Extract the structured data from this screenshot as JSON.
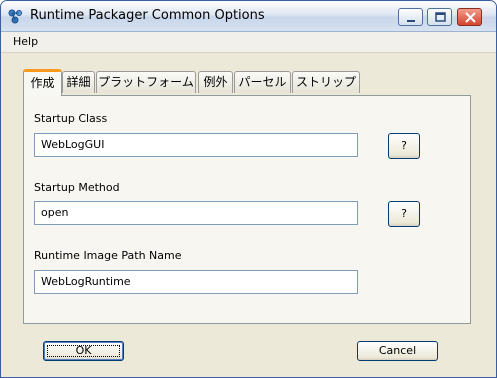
{
  "window": {
    "title": "Runtime Packager Common Options",
    "icon": "runtime-packager-icon",
    "controls": [
      "minimize-icon",
      "maximize-icon",
      "close-icon"
    ]
  },
  "menu": {
    "items": [
      {
        "label": "Help"
      }
    ]
  },
  "tabs": [
    {
      "label": "作成",
      "active": true
    },
    {
      "label": "詳細"
    },
    {
      "label": "プラットフォーム"
    },
    {
      "label": "例外"
    },
    {
      "label": "パーセル"
    },
    {
      "label": "ストリップ"
    }
  ],
  "form": {
    "startup_class": {
      "label": "Startup Class",
      "value": "WebLogGUI",
      "help": "?"
    },
    "startup_method": {
      "label": "Startup Method",
      "value": "open",
      "help": "?"
    },
    "image_path": {
      "label": "Runtime Image Path Name",
      "value": "WebLogRuntime"
    }
  },
  "buttons": {
    "ok": "OK",
    "cancel": "Cancel"
  },
  "colors": {
    "active_tab_accent": "#ff9a1f",
    "close_button": "#d4452f",
    "dialog_bg": "#ece9d8"
  }
}
